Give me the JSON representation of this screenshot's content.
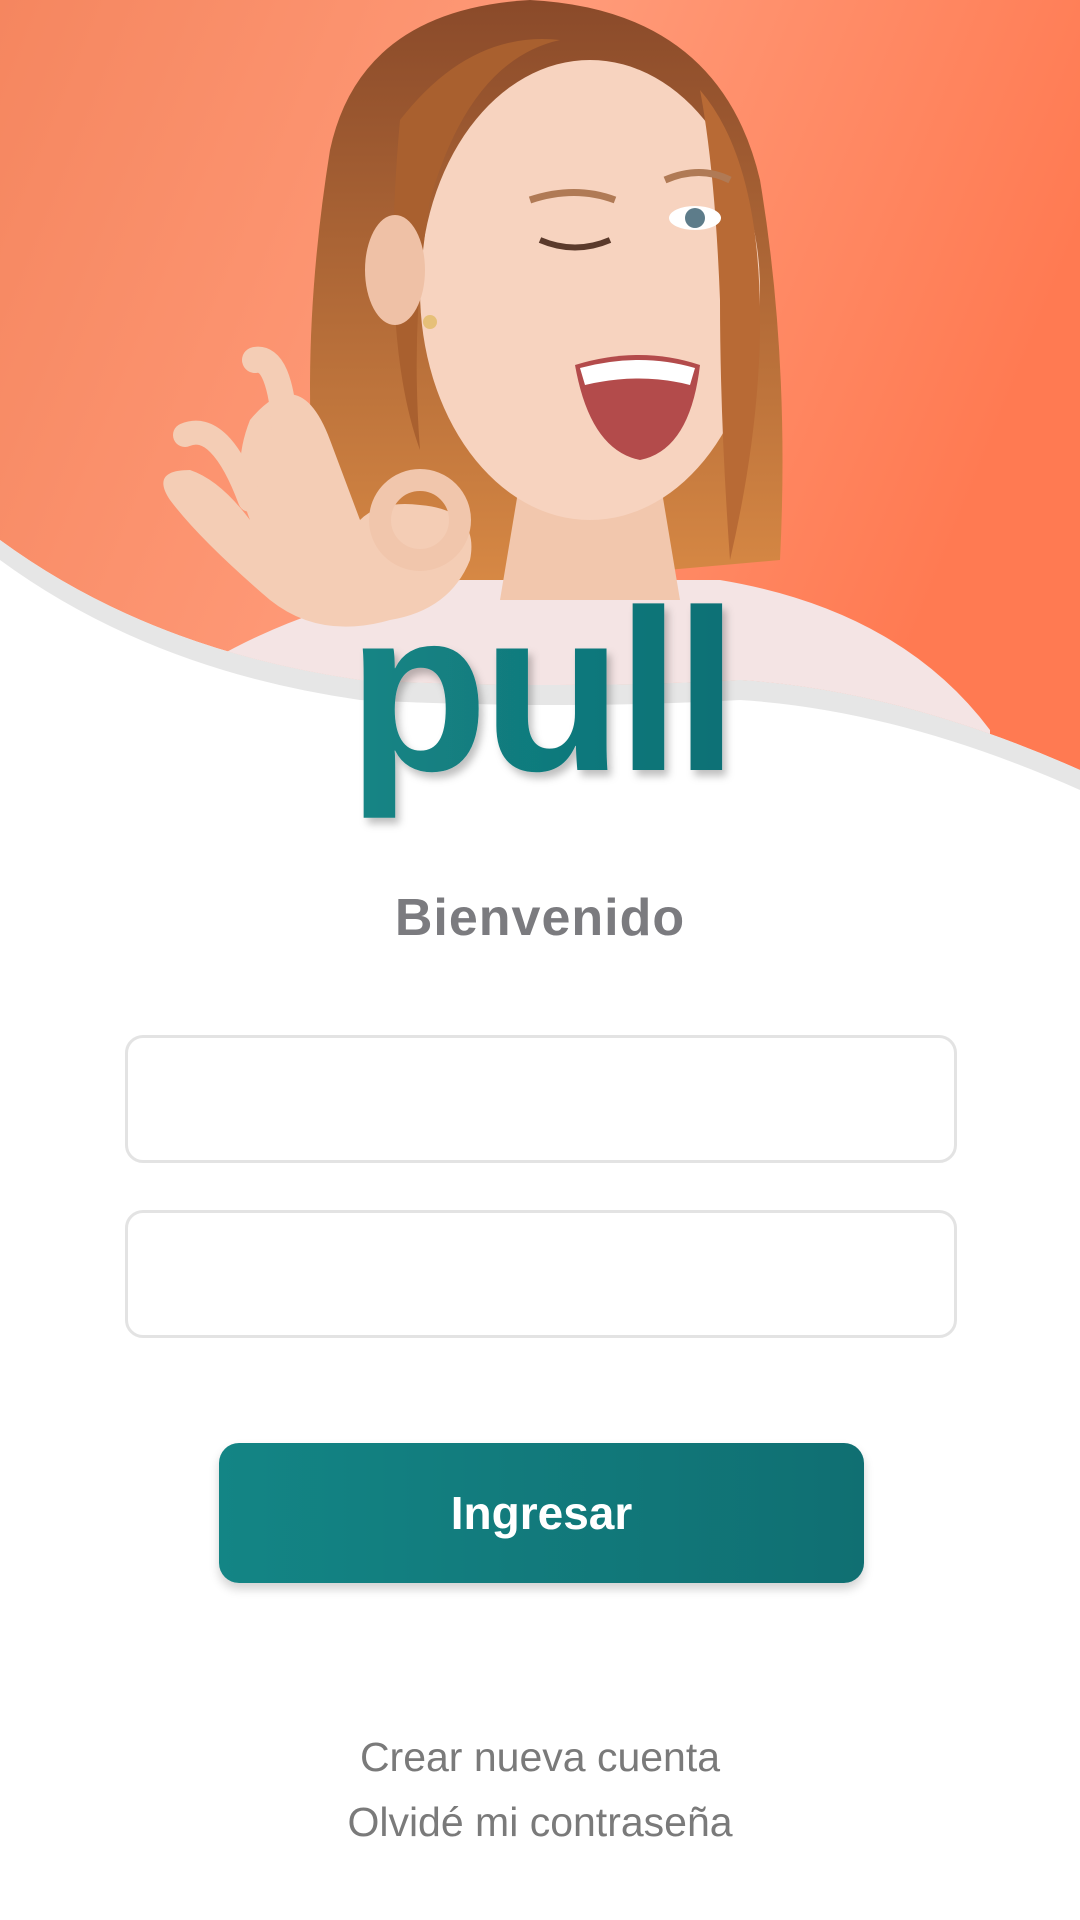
{
  "brand": {
    "logo_text": "pull",
    "logo_color": "#138585",
    "hero_background": "#ff7a55"
  },
  "login": {
    "welcome": "Bienvenido",
    "username_placeholder": "",
    "password_placeholder": "",
    "submit_label": "Ingresar"
  },
  "links": {
    "create_account": "Crear nueva cuenta",
    "forgot_password": "Olvidé mi contraseña"
  },
  "colors": {
    "accent": "#138585",
    "text_muted": "#7b7b7f",
    "field_border": "#e3e3e3"
  }
}
